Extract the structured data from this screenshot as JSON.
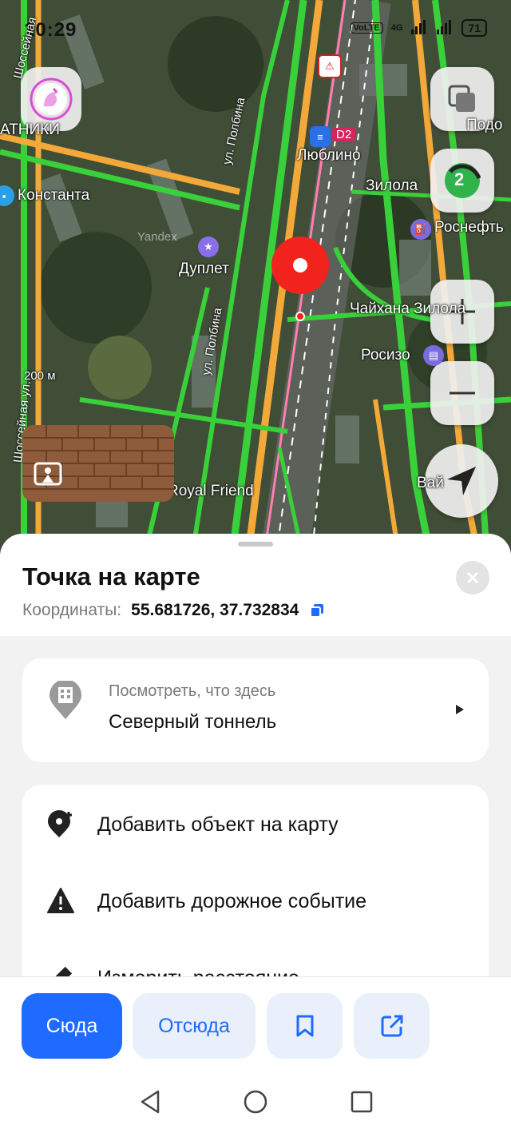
{
  "status_bar": {
    "time": "10:29",
    "battery": "71",
    "network": "4G",
    "volte": "VoLTE"
  },
  "map": {
    "labels": {
      "lyublino": "Люблино",
      "metro_line": "D2",
      "zilola": "Зилола",
      "konstanta": "Константа",
      "rosneft": "Роснефть",
      "duplet": "Дуплет",
      "chaihana": "Чайхана Зилола",
      "rosizo": "Росизо",
      "royal_friend": "Royal Friend",
      "vai": "Вай",
      "podo": "Подо",
      "atniki": "АТНИКИ",
      "polbina1": "ул. Полбина",
      "polbina2": "ул. Полбина",
      "shosseinaya": "Шоссейная ул.",
      "shosseinaya_top": "Шоссейная",
      "scale": "200 м",
      "yandex": "Yandex"
    },
    "route_badge": "2",
    "accent_color": "#1f6bff",
    "pin_color": "#f2221d"
  },
  "sheet": {
    "title": "Точка на карте",
    "coords_label": "Координаты:",
    "coords_value": "55.681726, 37.732834",
    "place_card": {
      "subtitle": "Посмотреть, что здесь",
      "name": "Северный тоннель"
    },
    "menu": [
      {
        "label": "Добавить объект на карту",
        "icon": "add-place-icon"
      },
      {
        "label": "Добавить дорожное событие",
        "icon": "warning-icon"
      },
      {
        "label": "Измерить расстояние",
        "icon": "ruler-icon"
      }
    ]
  },
  "actions": {
    "here": "Сюда",
    "from": "Отсюда"
  }
}
